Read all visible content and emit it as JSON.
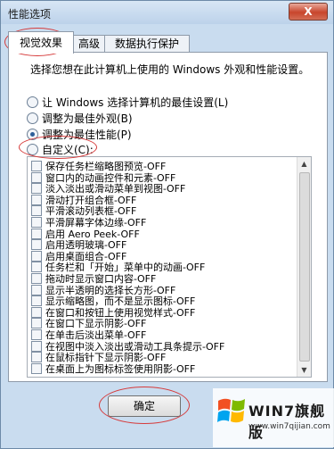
{
  "window": {
    "title": "性能选项",
    "close_label": "X"
  },
  "tabs": [
    "视觉效果",
    "高级",
    "数据执行保护"
  ],
  "description": "选择您想在此计算机上使用的 Windows 外观和性能设置。",
  "options": [
    {
      "label": "让 Windows 选择计算机的最佳设置(L)",
      "checked": false
    },
    {
      "label": "调整为最佳外观(B)",
      "checked": false
    },
    {
      "label": "调整为最佳性能(P)",
      "checked": true
    },
    {
      "label": "自定义(C):",
      "checked": false
    }
  ],
  "effects": [
    "保存任务栏缩略图预览-OFF",
    "窗口内的动画控件和元素-OFF",
    "淡入淡出或滑动菜单到视图-OFF",
    "滑动打开组合框-OFF",
    "平滑滚动列表框-OFF",
    "平滑屏幕字体边缘-OFF",
    "启用 Aero Peek-OFF",
    "启用透明玻璃-OFF",
    "启用桌面组合-OFF",
    "任务栏和「开始」菜单中的动画-OFF",
    "拖动时显示窗口内容-OFF",
    "显示半透明的选择长方形-OFF",
    "显示缩略图，而不是显示图标-OFF",
    "在窗口和按钮上使用视觉样式-OFF",
    "在窗口下显示阴影-OFF",
    "在单击后淡出菜单-OFF",
    "在视图中淡入淡出或滑动工具条提示-OFF",
    "在鼠标指针下显示阴影-OFF",
    "在桌面上为图标标签使用阴影-OFF"
  ],
  "ok_button": "确定",
  "watermark": {
    "brand": "WIN7旗舰版",
    "site": "www.win7qijian.com"
  },
  "colors": {
    "accent": "#2d5f99",
    "annotation": "#d63a3a"
  }
}
